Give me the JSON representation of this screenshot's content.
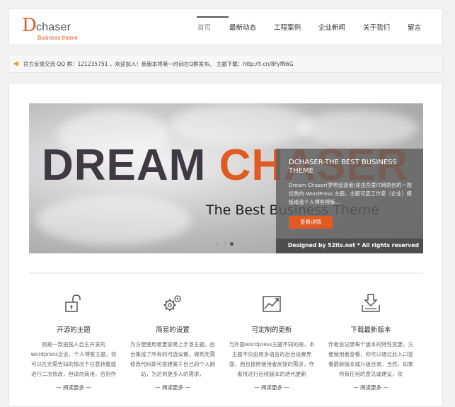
{
  "logo": {
    "initial": "D",
    "rest": "chaser",
    "subtitle": "Business theme"
  },
  "nav": {
    "items": [
      {
        "label": "首页",
        "active": true
      },
      {
        "label": "最新动态"
      },
      {
        "label": "工程案例"
      },
      {
        "label": "企业新闻"
      },
      {
        "label": "关于我们"
      },
      {
        "label": "留言"
      }
    ]
  },
  "notice": {
    "icon": "speaker-icon",
    "text": "官方反馈交流 QQ 群：121235751 ，欢迎加入！新版本将第一时间在Q群发布。 主题下载：http://t.cn/8FyfN6G"
  },
  "banner": {
    "headline_dark": "DREAM",
    "headline_accent": "CHASER",
    "tagline": "The Best Business Theme",
    "overlay_title": "DCHASER-THE BEST BUSINESS THEME",
    "overlay_desc": "Dream Chaser(梦想追逐者)是由吾爱IT网原创的一款优秀的 WordPress 主题，主题可选工作室（企业）模板或者个人博客模板…",
    "detail_button": "查看详情",
    "credit": "Designed by 52its.net * All rights reserved",
    "slides": 3,
    "active_slide": 3
  },
  "features": [
    {
      "icon": "lock-icon",
      "title": "开源的主题",
      "desc": "则是一款由国人自主开发的wordpress企业、个人博客主题，你可以在无需告知的情况下任意转载或进行二次修改，但请勿商用，否则作",
      "more": "— 阅读更多 —"
    },
    {
      "icon": "gears-icon",
      "title": "简易的设置",
      "desc": "为方便使用者更容易上手该主题，后台集成了所有的可选设置，做到无需修改代码即可搭建属于自己的个人网站，为达到更多人的需求，",
      "more": "— 阅读更多 —"
    },
    {
      "icon": "chart-icon",
      "title": "可定制的更新",
      "desc": "与外面wordpress主题不同的是，本主题不仅由用多语言的后台设置界面，而且按照使用者反馈的需求，作者将进行后续版本的迭代更新",
      "more": "— 阅读更多 —"
    },
    {
      "icon": "download-tray-icon",
      "title": "下载最新版本",
      "desc": "作者会记录每个版本的特性变更，方便使用者查看，你可以通过此入口查看最新版本或升级目录。当然，如果你有任何的意见或建议，欢",
      "more": "— 阅读更多 —"
    }
  ],
  "colors": {
    "accent": "#e05a22",
    "dark_text": "#3e3a44",
    "overlay": "#5f5f5f"
  }
}
